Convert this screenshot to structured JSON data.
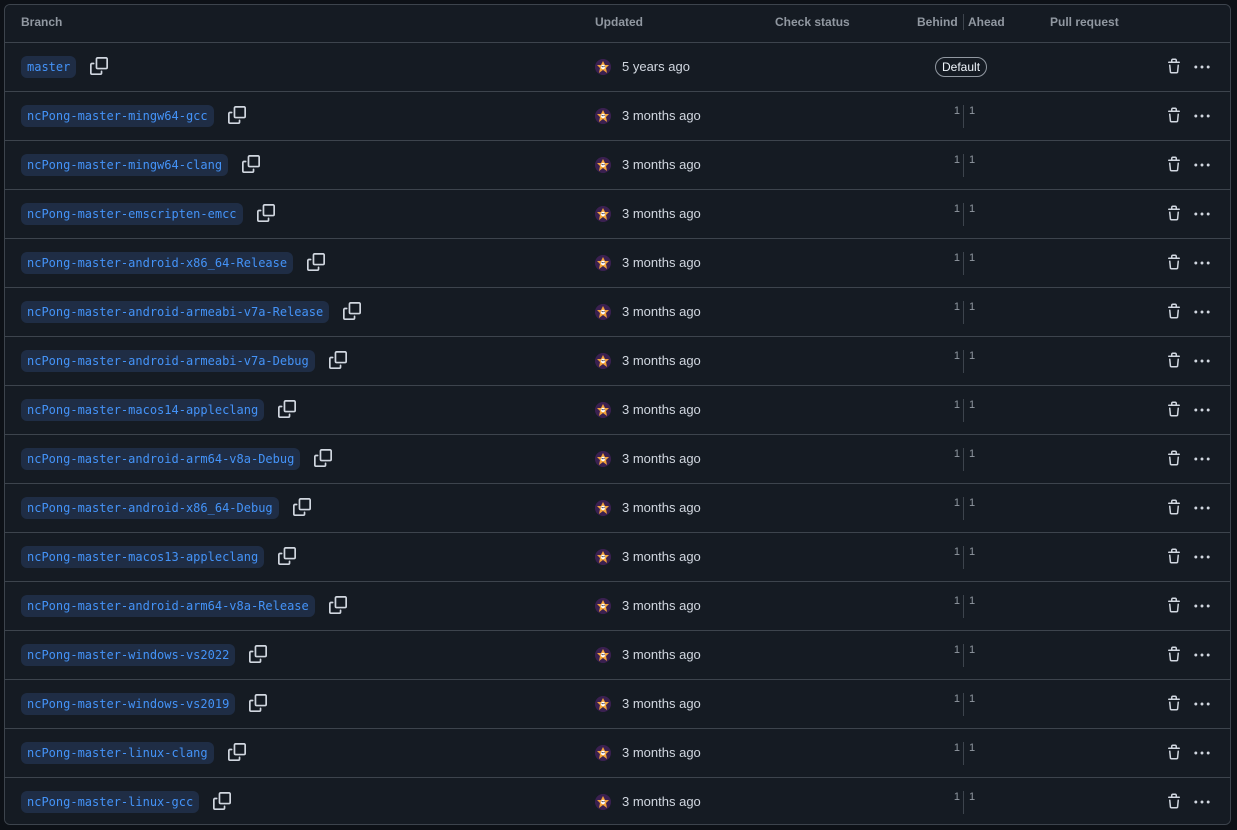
{
  "header": {
    "branch": "Branch",
    "updated": "Updated",
    "check_status": "Check status",
    "behind": "Behind",
    "ahead": "Ahead",
    "pull_request": "Pull request"
  },
  "default_badge": "Default",
  "branches": [
    {
      "name": "master",
      "updated": "5 years ago",
      "default": true,
      "behind": "",
      "ahead": ""
    },
    {
      "name": "ncPong-master-mingw64-gcc",
      "updated": "3 months ago",
      "behind": "1",
      "ahead": "1"
    },
    {
      "name": "ncPong-master-mingw64-clang",
      "updated": "3 months ago",
      "behind": "1",
      "ahead": "1"
    },
    {
      "name": "ncPong-master-emscripten-emcc",
      "updated": "3 months ago",
      "behind": "1",
      "ahead": "1"
    },
    {
      "name": "ncPong-master-android-x86_64-Release",
      "updated": "3 months ago",
      "behind": "1",
      "ahead": "1"
    },
    {
      "name": "ncPong-master-android-armeabi-v7a-Release",
      "updated": "3 months ago",
      "behind": "1",
      "ahead": "1"
    },
    {
      "name": "ncPong-master-android-armeabi-v7a-Debug",
      "updated": "3 months ago",
      "behind": "1",
      "ahead": "1"
    },
    {
      "name": "ncPong-master-macos14-appleclang",
      "updated": "3 months ago",
      "behind": "1",
      "ahead": "1"
    },
    {
      "name": "ncPong-master-android-arm64-v8a-Debug",
      "updated": "3 months ago",
      "behind": "1",
      "ahead": "1"
    },
    {
      "name": "ncPong-master-android-x86_64-Debug",
      "updated": "3 months ago",
      "behind": "1",
      "ahead": "1"
    },
    {
      "name": "ncPong-master-macos13-appleclang",
      "updated": "3 months ago",
      "behind": "1",
      "ahead": "1"
    },
    {
      "name": "ncPong-master-android-arm64-v8a-Release",
      "updated": "3 months ago",
      "behind": "1",
      "ahead": "1"
    },
    {
      "name": "ncPong-master-windows-vs2022",
      "updated": "3 months ago",
      "behind": "1",
      "ahead": "1"
    },
    {
      "name": "ncPong-master-windows-vs2019",
      "updated": "3 months ago",
      "behind": "1",
      "ahead": "1"
    },
    {
      "name": "ncPong-master-linux-clang",
      "updated": "3 months ago",
      "behind": "1",
      "ahead": "1"
    },
    {
      "name": "ncPong-master-linux-gcc",
      "updated": "3 months ago",
      "behind": "1",
      "ahead": "1"
    }
  ],
  "icons": {
    "copy": "copy-icon",
    "trash": "trash-icon",
    "kebab": "kebab-horizontal-icon",
    "avatar": "avatar"
  },
  "colors": {
    "background": "#0d1117",
    "table_bg": "#151b23",
    "border": "#3d444d",
    "branch_text": "#4493f8",
    "branch_pill_bg": "#1f2d45",
    "muted_text": "#9198a1",
    "text": "#d1d7e0"
  }
}
